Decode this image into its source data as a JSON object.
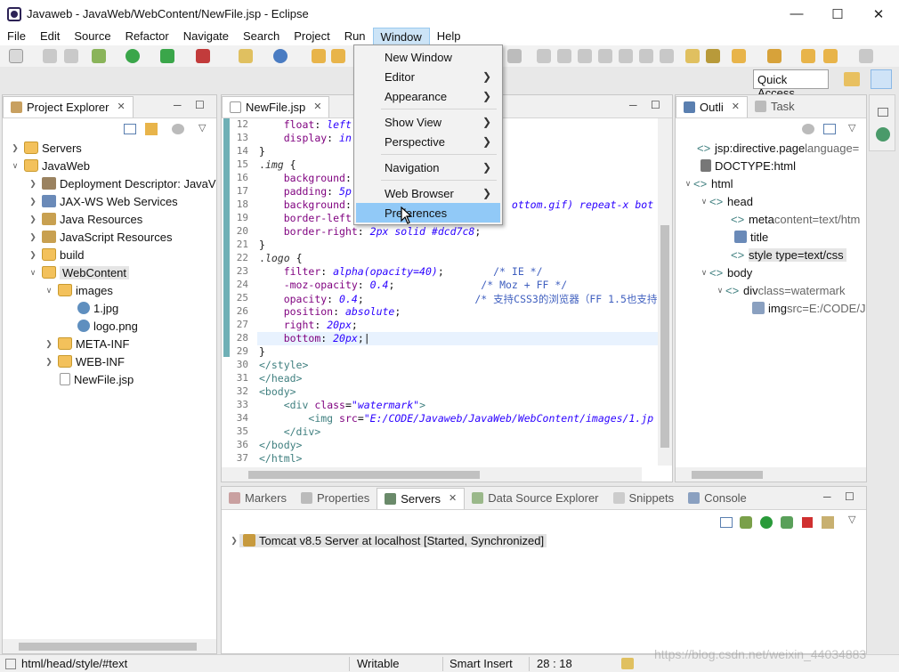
{
  "window": {
    "title": "Javaweb - JavaWeb/WebContent/NewFile.jsp - Eclipse"
  },
  "menubar": [
    "File",
    "Edit",
    "Source",
    "Refactor",
    "Navigate",
    "Search",
    "Project",
    "Run",
    "Window",
    "Help"
  ],
  "window_menu": {
    "new_window": "New Window",
    "editor": "Editor",
    "appearance": "Appearance",
    "show_view": "Show View",
    "perspective": "Perspective",
    "navigation": "Navigation",
    "web_browser": "Web Browser",
    "preferences": "Preferences"
  },
  "quick_access": "Quick Access",
  "project_explorer": {
    "tab": "Project Explorer",
    "items": [
      "Servers",
      "JavaWeb",
      "Deployment Descriptor: JavaV",
      "JAX-WS Web Services",
      "Java Resources",
      "JavaScript Resources",
      "build",
      "WebContent",
      "images",
      "1.jpg",
      "logo.png",
      "META-INF",
      "WEB-INF",
      "NewFile.jsp"
    ]
  },
  "editor": {
    "tab": "NewFile.jsp",
    "lines": [
      {
        "n": "12",
        "html": "    <span class='prop'>float</span>: <span class='val'>left</span>;"
      },
      {
        "n": "13",
        "html": "    <span class='prop'>display</span>: <span class='val'>in</span>"
      },
      {
        "n": "14",
        "html": "}"
      },
      {
        "n": "15",
        "html": "<span class='kw-sel'>.<i>img</i></span> {"
      },
      {
        "n": "16",
        "html": "    <span class='prop'>background</span>:"
      },
      {
        "n": "17",
        "html": "    <span class='prop'>padding</span>: <span class='val'>5p</span>"
      },
      {
        "n": "18",
        "html": "    <span class='prop'>background</span>:                          <span class='val'>ottom.gif) repeat-x bot</span>"
      },
      {
        "n": "19",
        "html": "    <span class='prop'>border-left</span>"
      },
      {
        "n": "20",
        "html": "    <span class='prop'>border-right</span>: <span class='val'>2px solid #dcd7c8</span>;"
      },
      {
        "n": "21",
        "html": "}"
      },
      {
        "n": "22",
        "html": "<span class='kw-sel'>.<i>logo</i></span> {"
      },
      {
        "n": "23",
        "html": "    <span class='prop'>filter</span>: <span class='val'>alpha(opacity=40)</span>;        <span class='cmt'>/* IE */</span>"
      },
      {
        "n": "24",
        "html": "    <span class='prop'>-moz-opacity</span>: <span class='val'>0.4</span>;              <span class='cmt'>/* Moz + FF */</span>"
      },
      {
        "n": "25",
        "html": "    <span class='prop'>opacity</span>: <span class='val'>0.4</span>;                  <span class='cmt'>/* 支持CSS3的浏览器（FF 1.5也支持</span>"
      },
      {
        "n": "26",
        "html": "    <span class='prop'>position</span>: <span class='val'>absolute</span>;"
      },
      {
        "n": "27",
        "html": "    <span class='prop'>right</span>: <span class='val'>20px</span>;"
      },
      {
        "n": "28",
        "html": "    <span class='prop'>bottom</span>: <span class='val'>20px</span>;|"
      },
      {
        "n": "29",
        "html": "}"
      },
      {
        "n": "30",
        "html": "<span class='tag'>&lt;/style&gt;</span>"
      },
      {
        "n": "31",
        "html": "<span class='tag'>&lt;/head&gt;</span>"
      },
      {
        "n": "32",
        "html": "<span class='tag'>&lt;body&gt;</span>"
      },
      {
        "n": "33",
        "html": "    <span class='tag'>&lt;div</span> <span class='attr'>class</span>=<span class='str'>\"watermark\"</span><span class='tag'>&gt;</span>"
      },
      {
        "n": "34",
        "html": "        <span class='tag'>&lt;img</span> <span class='attr'>src</span>=<span class='str'>\"E:/CODE/Javaweb/JavaWeb/WebContent/images/1.jp</span>"
      },
      {
        "n": "35",
        "html": "    <span class='tag'>&lt;/div&gt;</span>"
      },
      {
        "n": "36",
        "html": "<span class='tag'>&lt;/body&gt;</span>"
      },
      {
        "n": "37",
        "html": "<span class='tag'>&lt;/html&gt;</span>"
      }
    ]
  },
  "outline": {
    "tab": "Outli",
    "tab2": "Task",
    "items": [
      {
        "label": "jsp:directive.page",
        "extra": " language="
      },
      {
        "label": "DOCTYPE:html",
        "extra": ""
      },
      {
        "label": "html",
        "extra": ""
      },
      {
        "label": "head",
        "extra": ""
      },
      {
        "label": "meta",
        "extra": " content=text/htm"
      },
      {
        "label": "title",
        "extra": ""
      },
      {
        "label": "style type=text/css",
        "extra": ""
      },
      {
        "label": "body",
        "extra": ""
      },
      {
        "label": "div",
        "extra": " class=watermark"
      },
      {
        "label": "img",
        "extra": " src=E:/CODE/J"
      }
    ]
  },
  "bottom": {
    "tabs": [
      "Markers",
      "Properties",
      "Servers",
      "Data Source Explorer",
      "Snippets",
      "Console"
    ],
    "server_entry": "Tomcat v8.5 Server at localhost  [Started, Synchronized]"
  },
  "status": {
    "path": "html/head/style/#text",
    "writable": "Writable",
    "insert": "Smart Insert",
    "position": "28 : 18",
    "watermark": "https://blog.csdn.net/weixin_44034883"
  }
}
